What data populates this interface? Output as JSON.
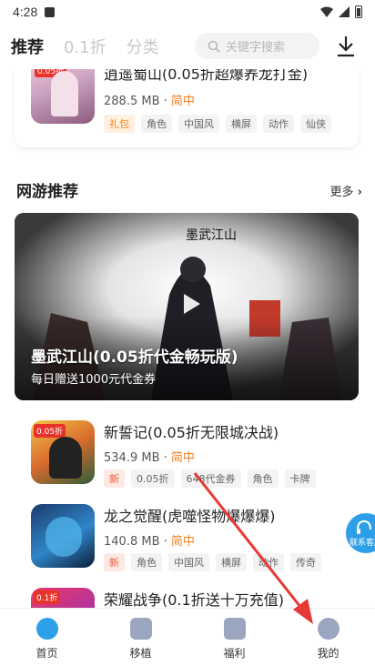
{
  "status": {
    "time": "4:28"
  },
  "topbar": {
    "tabs": [
      "推荐",
      "0.1折",
      "分类"
    ],
    "search_placeholder": "关键字搜索"
  },
  "games": [
    {
      "title": "逍遥蜀山(0.05折超爆养龙打金)",
      "size": "288.5 MB",
      "lang": "简中",
      "tags": [
        "礼包",
        "角色",
        "中国风",
        "横屏",
        "动作",
        "仙侠"
      ]
    },
    {
      "title": "新誓记(0.05折无限城决战)",
      "size": "534.9 MB",
      "lang": "简中",
      "tags": [
        "新",
        "0.05折",
        "648代金券",
        "角色",
        "卡牌"
      ]
    },
    {
      "title": "龙之觉醒(虎噬怪物爆爆爆)",
      "size": "140.8 MB",
      "lang": "简中",
      "tags": [
        "新",
        "角色",
        "中国风",
        "横屏",
        "动作",
        "传奇"
      ]
    },
    {
      "title": "荣耀战争(0.1折送十万充值)"
    }
  ],
  "section": {
    "title": "网游推荐",
    "more": "更多"
  },
  "banner": {
    "title": "墨武江山(0.05折代金畅玩版)",
    "subtitle": "每日赠送1000元代金券",
    "art_text": "墨武江山",
    "thumb_badge": "0.05折"
  },
  "float_button": {
    "label": "联系客服"
  },
  "bottom_nav": {
    "items": [
      "首页",
      "移植",
      "福利",
      "我的"
    ]
  },
  "colors": {
    "accent": "#f5801f",
    "nav_active": "#2d9fe8"
  }
}
